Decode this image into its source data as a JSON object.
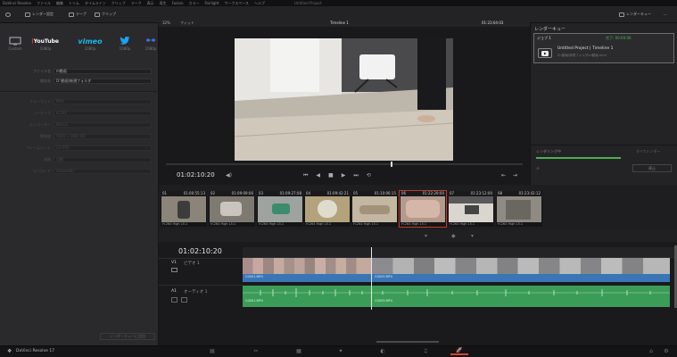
{
  "menubar": {
    "items": [
      "DaVinci Resolve",
      "ファイル",
      "編集",
      "トリム",
      "タイムライン",
      "クリップ",
      "マーク",
      "表示",
      "再生",
      "Fusion",
      "カラー",
      "Fairlight",
      "ワークスペース",
      "ヘルプ"
    ],
    "project_title": "Untitled Project"
  },
  "toolbar": {
    "render_settings": "レンダー設定",
    "tape": "テープ",
    "clip": "クリップ",
    "render_queue": "レンダーキュー"
  },
  "presets": [
    {
      "label": "Custom",
      "icon": "monitor-icon",
      "color": "#9aa0a6"
    },
    {
      "label": "1080p",
      "icon": "youtube-icon",
      "text": "YouTube",
      "color": "#e52d27"
    },
    {
      "label": "1080p",
      "icon": "vimeo-icon",
      "text": "vimeo",
      "color": "#1ab7ea"
    },
    {
      "label": "1080p",
      "icon": "twitter-icon",
      "text": "",
      "color": "#1da1f2"
    },
    {
      "label": "1080p",
      "icon": "dropbox-icon",
      "text": "",
      "color": "#3d6fe0"
    }
  ],
  "left_fields": {
    "name_label": "ファイル名",
    "name_value": "m動画",
    "location_label": "保存先",
    "location_value": "D:\\動画\\新規フォルダ",
    "render_rows": [
      {
        "label": "フォーマット",
        "value": "MP4"
      },
      {
        "label": "コーデック",
        "value": "H.264"
      },
      {
        "label": "エンコーダー",
        "value": "Native"
      },
      {
        "label": "解像度",
        "value": "1920 x 1080 HD"
      },
      {
        "label": "フレームレート",
        "value": "23.976"
      },
      {
        "label": "画質",
        "value": "自動"
      },
      {
        "label": "エンコード",
        "value": "Automatic"
      }
    ],
    "add_queue": "レンダーキューに追加"
  },
  "viewer": {
    "zoom": "32%",
    "fit": "フィット",
    "timeline_name": "Timeline 1",
    "timecode_top": "01:23:04:03",
    "timecode": "01:02:10:20"
  },
  "render_queue": {
    "title": "レンダーキュー",
    "job": "ジョブ 1",
    "job_status": "完了: 00:00:06",
    "project": "Untitled Project | Timeline 1",
    "path": "D:\\動画\\新規フォルダ\\m動画.mp4",
    "render_status": "レンダリング中",
    "render_all": "すべてレンダー",
    "render_button": "停止"
  },
  "clips": [
    {
      "num": "01",
      "tc": "01:00:55:13",
      "codec": "H.264 High L5.1",
      "color": "#8b8478"
    },
    {
      "num": "02",
      "tc": "01:09:09:06",
      "codec": "H.264 High L5.1",
      "color": "#7e7a72"
    },
    {
      "num": "03",
      "tc": "01:09:27:08",
      "codec": "H.264 High L5.1",
      "color": "#9fa3a0"
    },
    {
      "num": "04",
      "tc": "01:09:42:21",
      "codec": "H.264 High L5.1",
      "color": "#b2a37c"
    },
    {
      "num": "05",
      "tc": "01:10:06:15",
      "codec": "H.264 High L5.1",
      "color": "#c3b7a2"
    },
    {
      "num": "06",
      "tc": "01:22:29:00",
      "codec": "H.264 High L5.1",
      "color": "#b39a8c"
    },
    {
      "num": "07",
      "tc": "01:23:12:00",
      "codec": "H.264 High L5.1",
      "color": "#d8d6cf"
    },
    {
      "num": "08",
      "tc": "01:23:42:12",
      "codec": "H.264 High L5.1",
      "color": "#8f8b84"
    }
  ],
  "timeline": {
    "timecode": "01:02:10:20",
    "video_track": "V1",
    "video_track_name": "ビデオ 1",
    "audio_track": "A1",
    "audio_track_name": "オーディオ 1",
    "clip_name_a": "C0001.MP4",
    "clip_name_b": "C0003.MP4",
    "video_color": "#3a76b5",
    "audio_color": "#3b9c57"
  },
  "statusbar": {
    "app_name": "DaVinci Resolve 17"
  }
}
